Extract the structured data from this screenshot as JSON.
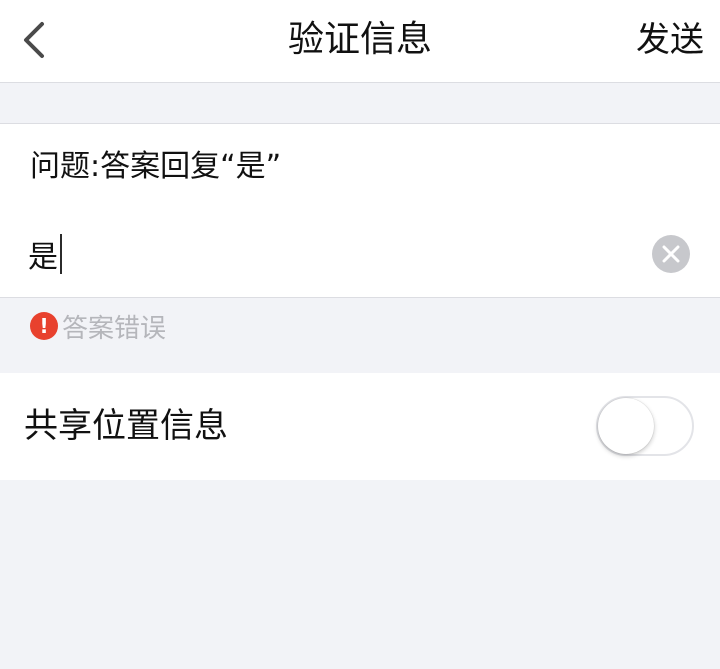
{
  "nav": {
    "title": "验证信息",
    "send_label": "发送",
    "back_icon": "chevron-left-icon"
  },
  "question": {
    "text": "问题:答案回复“是”"
  },
  "answer": {
    "value": "是",
    "clear_icon": "clear-icon"
  },
  "error": {
    "icon": "alert-circle-icon",
    "icon_glyph": "!",
    "text": "答案错误",
    "color": "#e8412e"
  },
  "share_location": {
    "label": "共享位置信息",
    "enabled": false
  },
  "colors": {
    "background": "#f2f3f7",
    "card": "#ffffff",
    "divider": "#dcdde2",
    "muted_text": "#b5b6bb"
  }
}
